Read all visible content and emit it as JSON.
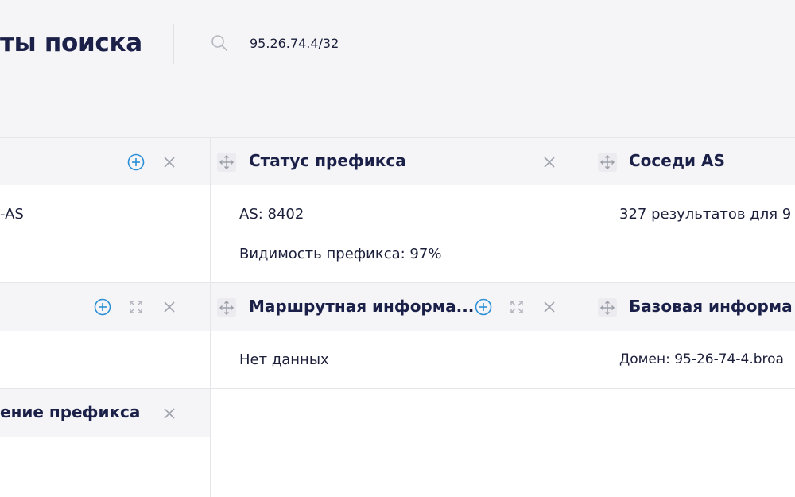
{
  "header": {
    "title": "ты поиска",
    "search_value": "95.26.74.4/32",
    "search_icon": "search-icon"
  },
  "widgets": {
    "w1": {
      "body": "-AS"
    },
    "prefix_status": {
      "title": "Статус префикса",
      "lines": [
        "AS: 8402",
        "Видимость префикса: 97%"
      ]
    },
    "as_neighbors": {
      "title": "Соседи AS",
      "body": "327 результатов для 9"
    },
    "routing_info": {
      "title": "Маршрутная информа...",
      "body": "Нет данных"
    },
    "basic_info": {
      "title": "Базовая информа",
      "body": "Домен: 95-26-74-4.broa"
    },
    "w6": {
      "title": "ение префикса"
    }
  },
  "icons": {
    "drag": "move-icon",
    "add": "plus-circle-icon",
    "expand": "expand-icon",
    "close": "close-icon"
  },
  "colors": {
    "accent": "#2a8fd6",
    "title": "#1b2048",
    "icon_gray": "#a0a3ad"
  }
}
